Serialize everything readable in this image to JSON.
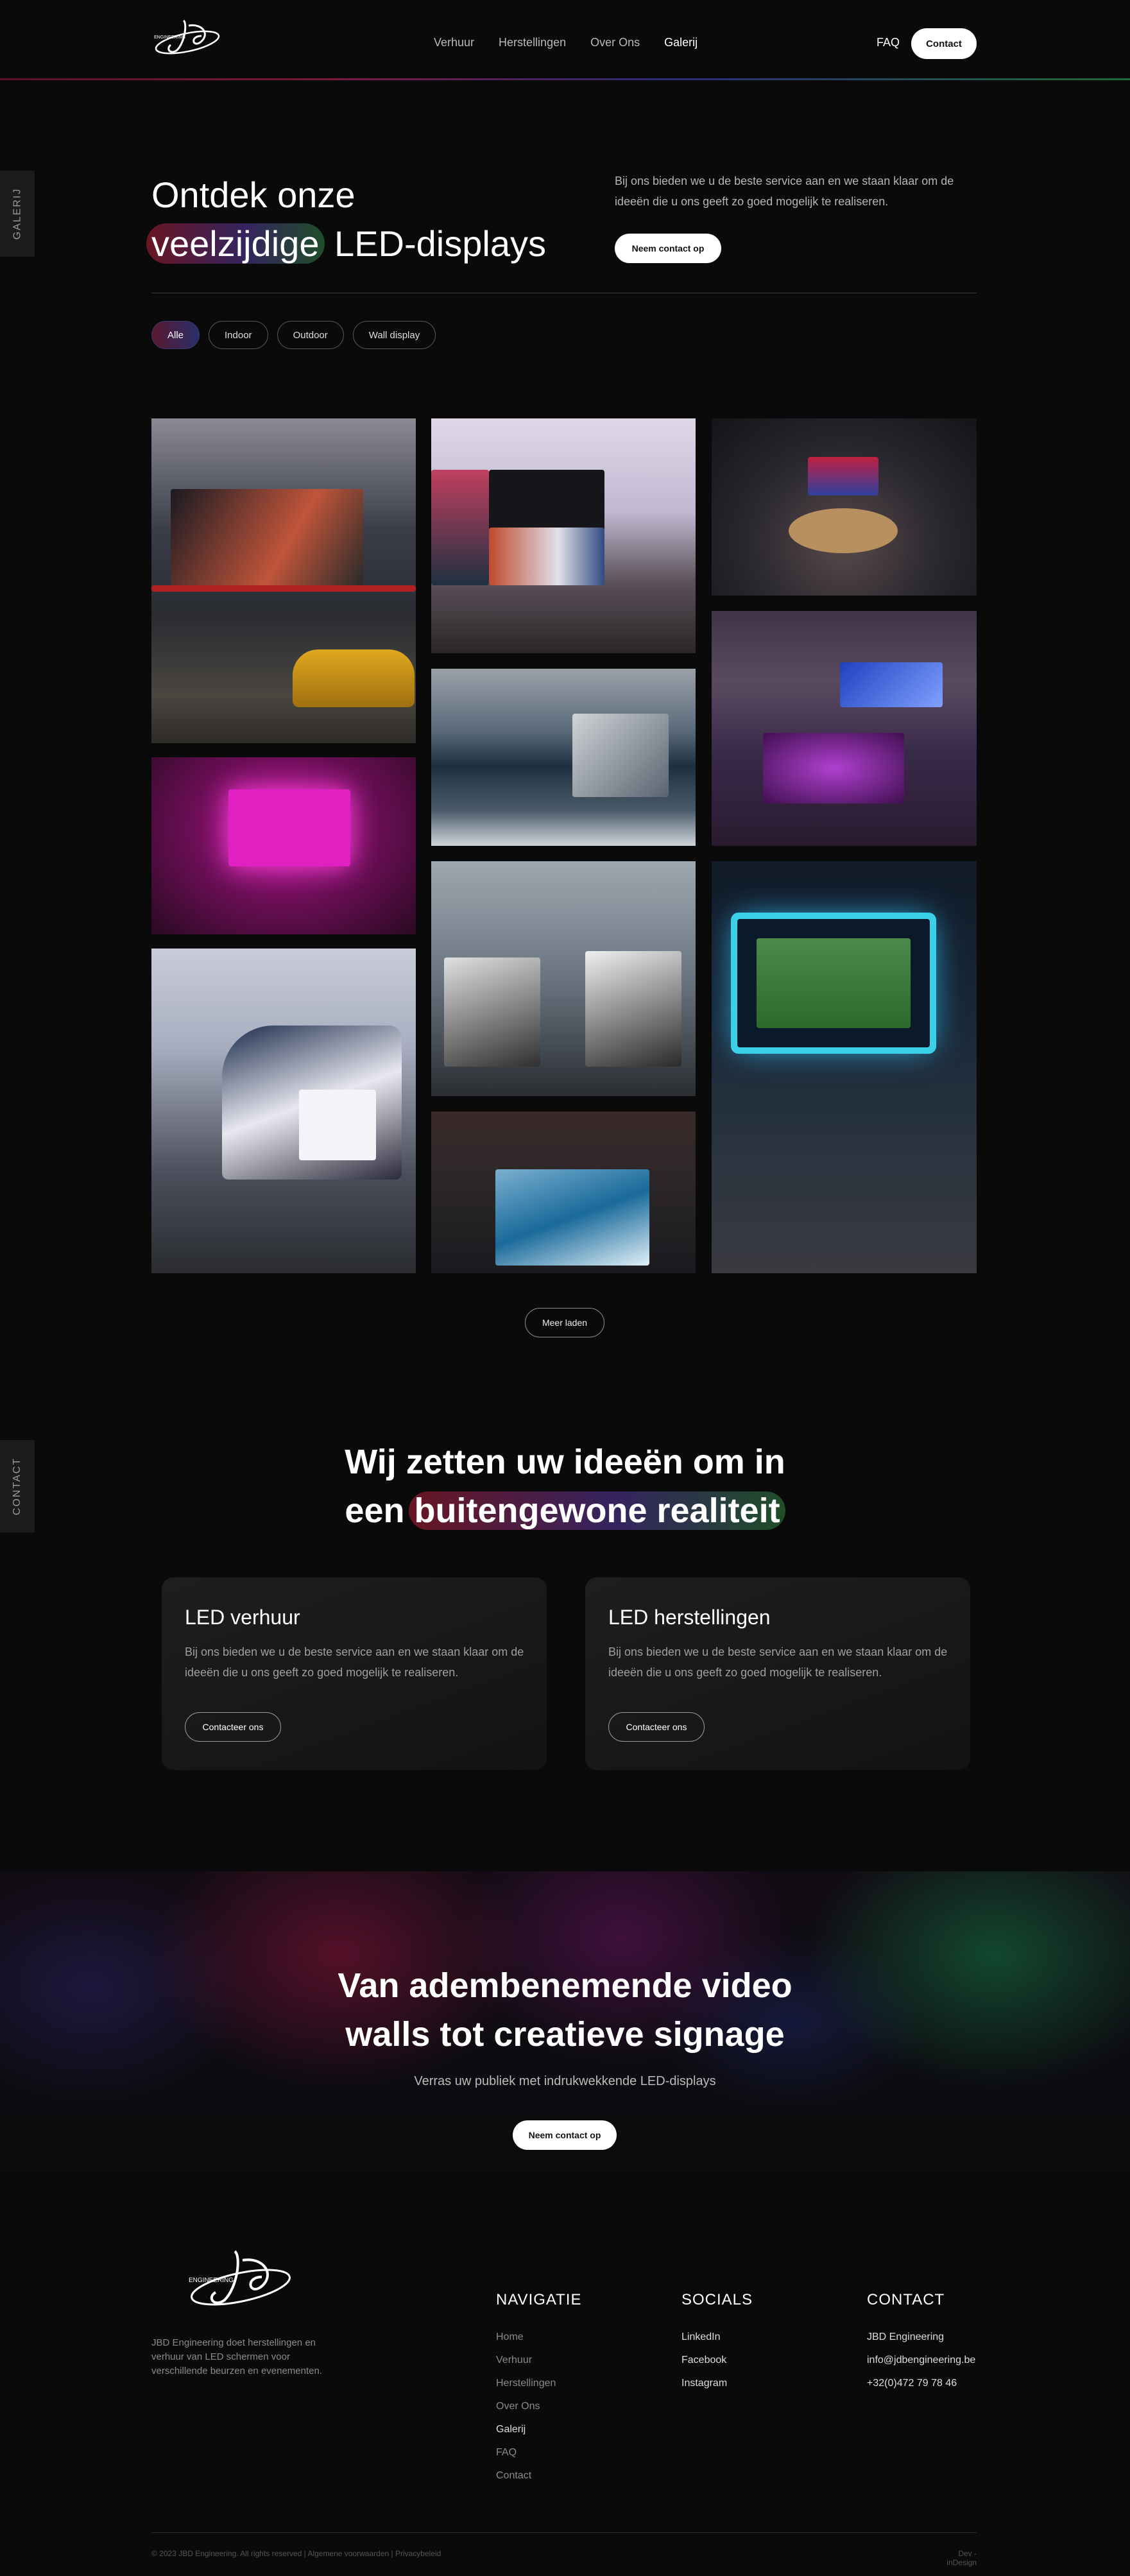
{
  "nav": {
    "items": [
      "Verhuur",
      "Herstellingen",
      "Over Ons",
      "Galerij"
    ],
    "active_index": 3,
    "faq": "FAQ",
    "contact": "Contact"
  },
  "side_tabs": {
    "gallery": "GALERIJ",
    "contact": "CONTACT"
  },
  "hero": {
    "title_line1": "Ontdek onze",
    "title_highlight": "veelzijdige",
    "title_rest": " LED-displays",
    "description": "Bij ons bieden we u de beste service aan en we staan klaar om de ideeën die u ons geeft zo goed mogelijk te realiseren.",
    "cta": "Neem contact op"
  },
  "filters": [
    "Alle",
    "Indoor",
    "Outdoor",
    "Wall display"
  ],
  "gallery": {
    "load_more": "Meer laden"
  },
  "ideas": {
    "title_line1": "Wij zetten uw ideeën om in",
    "title_pre": "een ",
    "title_highlight": "buitengewone realiteit",
    "cards": [
      {
        "title": "LED verhuur",
        "description": "Bij ons bieden we u de beste service aan en we staan klaar om de ideeën die u ons geeft zo goed mogelijk te realiseren.",
        "cta": "Contacteer ons"
      },
      {
        "title": "LED herstellingen",
        "description": "Bij ons bieden we u de beste service aan en we staan klaar om de ideeën die u ons geeft zo goed mogelijk te realiseren.",
        "cta": "Contacteer ons"
      }
    ]
  },
  "cta_band": {
    "title_line1": "Van adembenemende video",
    "title_line2": "walls tot creatieve signage",
    "subtitle": "Verras uw publiek met indrukwekkende LED-displays",
    "cta": "Neem contact op"
  },
  "footer": {
    "about": "JBD Engineering doet herstellingen en verhuur van LED schermen voor verschillende beurzen en evenementen.",
    "navigation": {
      "heading": "NAVIGATIE",
      "links": [
        "Home",
        "Verhuur",
        "Herstellingen",
        "Over Ons",
        "Galerij",
        "FAQ",
        "Contact"
      ]
    },
    "socials": {
      "heading": "SOCIALS",
      "links": [
        "LinkedIn",
        "Facebook",
        "Instagram"
      ]
    },
    "contact": {
      "heading": "CONTACT",
      "lines": [
        "JBD Engineering",
        "info@jdbengineering.be",
        "+32(0)472 79 78 46"
      ]
    },
    "copyright": "© 2023 JBD Engineering. All rights reserved | Algemene voorwaarden | Privacybeleid",
    "developer": "Dev - inDesign"
  },
  "colors": {
    "background": "#0a0a0a",
    "accent_red": "#7a1828",
    "accent_blue": "#2a2e7a",
    "accent_green": "#1f6a35"
  }
}
